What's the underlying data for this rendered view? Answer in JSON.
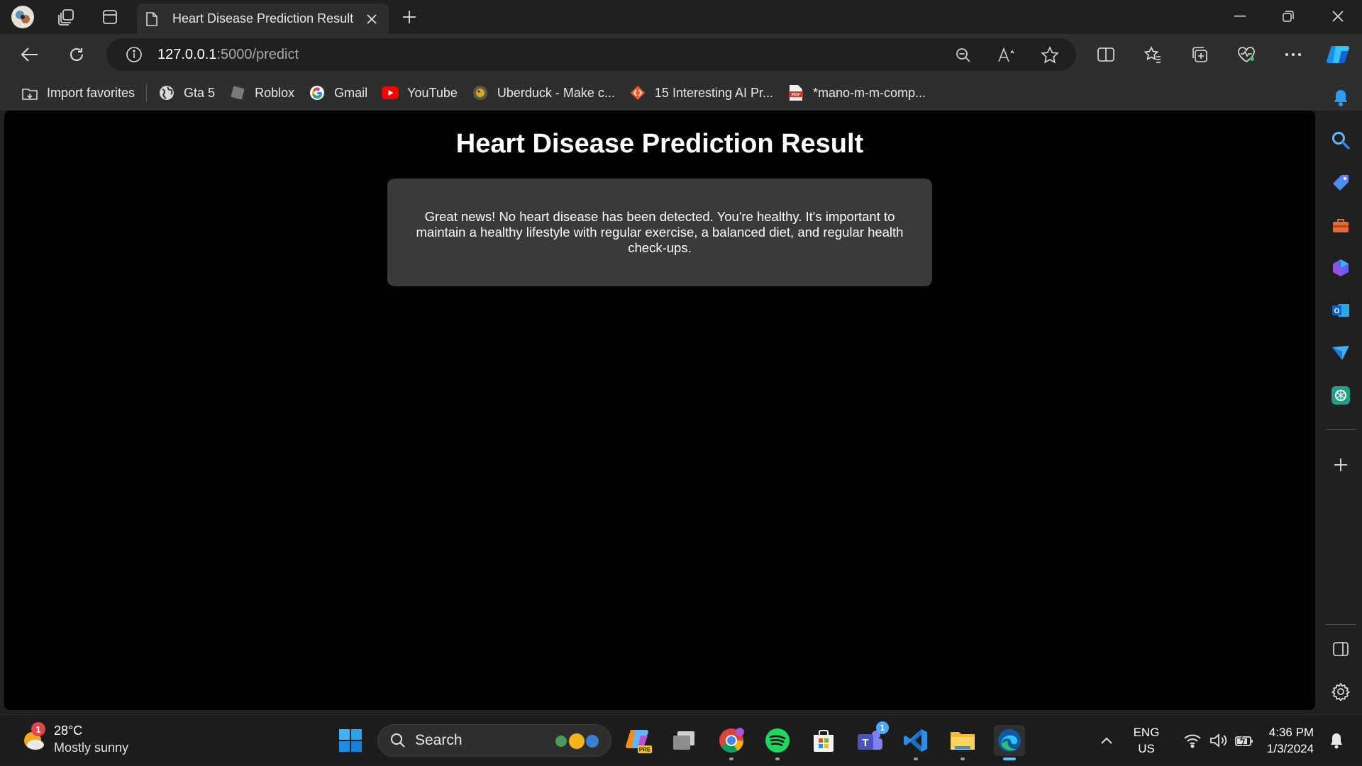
{
  "browser": {
    "tab_title": "Heart Disease Prediction Result",
    "url_host": "127.0.0.1",
    "url_path": ":5000/predict"
  },
  "favorites": [
    {
      "label": "Import favorites",
      "icon": "import-icon"
    },
    {
      "label": "Gta 5",
      "icon": "globe-icon"
    },
    {
      "label": "Roblox",
      "icon": "roblox-icon"
    },
    {
      "label": "Gmail",
      "icon": "google-icon"
    },
    {
      "label": "YouTube",
      "icon": "youtube-icon"
    },
    {
      "label": "Uberduck - Make c...",
      "icon": "uberduck-icon"
    },
    {
      "label": "15 Interesting AI Pr...",
      "icon": "code-icon"
    },
    {
      "label": "*mano-m-m-comp...",
      "icon": "pdf-icon"
    }
  ],
  "page": {
    "title": "Heart Disease Prediction Result",
    "result_message": "Great news! No heart disease has been detected. You're healthy. It's important to maintain a healthy lifestyle with regular exercise, a balanced diet, and regular health check-ups."
  },
  "taskbar": {
    "weather_temp": "28°C",
    "weather_condition": "Mostly sunny",
    "weather_badge": "1",
    "search_label": "Search",
    "teams_badge": "1",
    "lang_line1": "ENG",
    "lang_line2": "US",
    "time": "4:36 PM",
    "date": "1/3/2024"
  },
  "colors": {
    "page_background": "#000000",
    "card_background": "#3a3a3c",
    "chrome_dark": "#202020",
    "chrome_toolbar": "#2e2e2e",
    "accent": "#4cc2ff"
  }
}
